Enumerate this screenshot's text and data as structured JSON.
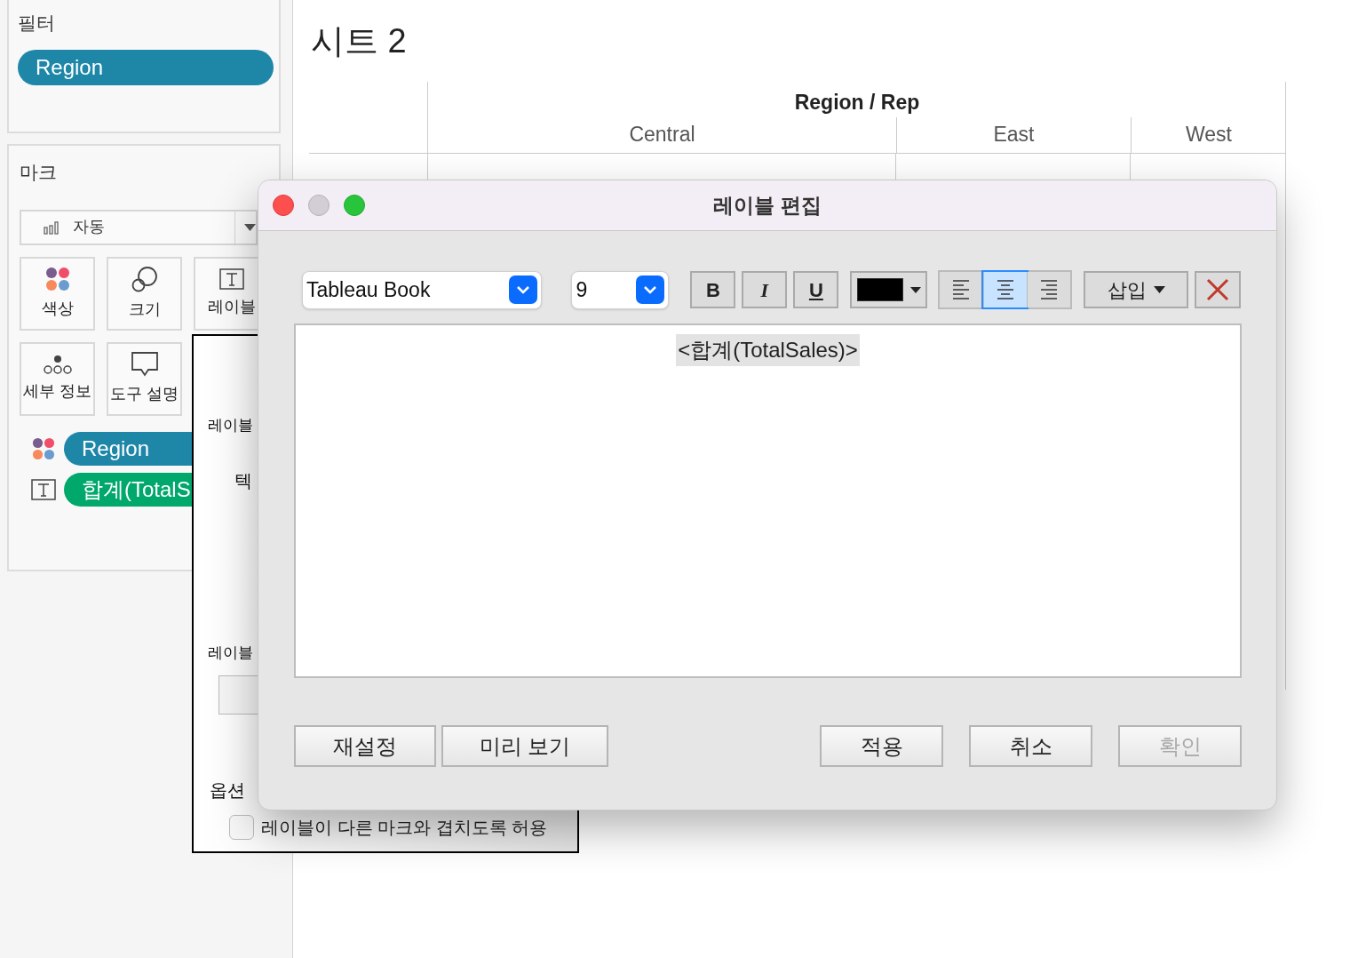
{
  "filters": {
    "title": "필터",
    "pills": [
      {
        "label": "Region",
        "color": "#1e87a8"
      }
    ]
  },
  "marks": {
    "title": "마크",
    "mark_type": "자동",
    "cards": [
      {
        "label": "색상",
        "kind": "color"
      },
      {
        "label": "크기",
        "kind": "size"
      },
      {
        "label": "레이블",
        "kind": "label"
      },
      {
        "label": "세부 정보",
        "kind": "detail"
      },
      {
        "label": "도구 설명",
        "kind": "tooltip"
      }
    ],
    "fields": [
      {
        "kind": "color",
        "label": "Region",
        "color": "#1e87a8"
      },
      {
        "kind": "label",
        "label": "합계(TotalS",
        "color": "#00a86b"
      }
    ]
  },
  "label_panel": {
    "heading_1": "레이블",
    "text_row": "텍",
    "heading_2": "레이블",
    "options_title": "옵션",
    "overlap_option": {
      "label": "레이블이 다른 마크와 겹치도록 허용",
      "checked": false
    }
  },
  "sheet": {
    "title": "시트 2",
    "header": {
      "title": "Region / Rep",
      "columns": [
        "Central",
        "East",
        "West"
      ]
    }
  },
  "dialog": {
    "title": "레이블 편집",
    "font": "Tableau Book",
    "size": "9",
    "format_buttons": [
      {
        "label": "B",
        "kind": "bold",
        "on": false
      },
      {
        "label": "I",
        "kind": "italic",
        "on": false
      },
      {
        "label": "U",
        "kind": "underline",
        "on": false
      }
    ],
    "alignment": [
      {
        "kind": "left",
        "selected": false
      },
      {
        "kind": "center",
        "selected": true
      },
      {
        "kind": "right",
        "selected": false
      }
    ],
    "insert": "삽입",
    "editor_text": "<합계(TotalSales)>",
    "buttons": [
      {
        "label": "재설정",
        "disabled": false
      },
      {
        "label": "미리 보기",
        "disabled": false
      },
      {
        "label": "적용",
        "disabled": false
      },
      {
        "label": "취소",
        "disabled": false
      },
      {
        "label": "확인",
        "disabled": true
      }
    ]
  }
}
